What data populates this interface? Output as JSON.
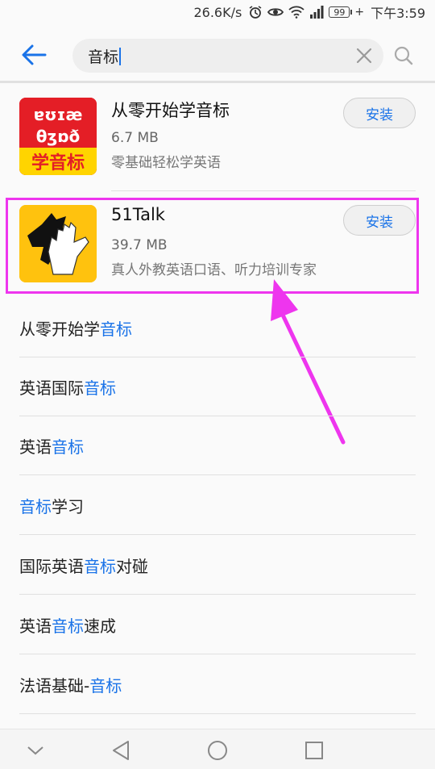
{
  "status": {
    "speed": "26.6K/s",
    "battery": "99",
    "time": "下午3:59"
  },
  "search": {
    "query": "音标"
  },
  "apps": [
    {
      "name": "从零开始学音标",
      "size": "6.7 MB",
      "desc": "零基础轻松学英语",
      "install_label": "安装",
      "icon_lines": [
        "ɐʊɪæ",
        "θʒɒð",
        "学音标"
      ]
    },
    {
      "name": "51Talk",
      "size": "39.7 MB",
      "desc": "真人外教英语口语、听力培训专家",
      "install_label": "安装"
    }
  ],
  "suggestions": [
    {
      "before": "从零开始学",
      "match": "音标",
      "after": ""
    },
    {
      "before": "英语国际",
      "match": "音标",
      "after": ""
    },
    {
      "before": "英语",
      "match": "音标",
      "after": ""
    },
    {
      "before": "",
      "match": "音标",
      "after": "学习"
    },
    {
      "before": "国际英语",
      "match": "音标",
      "after": "对碰"
    },
    {
      "before": "英语",
      "match": "音标",
      "after": "速成"
    },
    {
      "before": "法语基础-",
      "match": "音标",
      "after": ""
    }
  ],
  "colors": {
    "accent": "#1a73e8",
    "highlight_annotation": "#ee35ee"
  }
}
